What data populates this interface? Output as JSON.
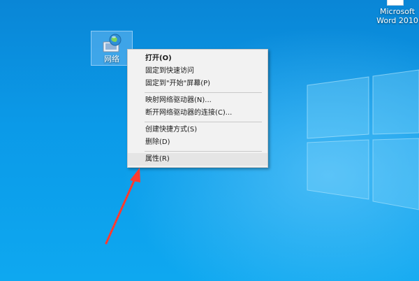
{
  "desktop": {
    "icons": {
      "network": {
        "label": "网络"
      },
      "word": {
        "label_line1": "Microsoft",
        "label_line2": "Word 2010"
      }
    }
  },
  "context_menu": {
    "items": [
      {
        "label": "打开(O)",
        "bold": true
      },
      {
        "label": "固定到快速访问"
      },
      {
        "label": "固定到\"开始\"屏幕(P)"
      },
      {
        "label": "映射网络驱动器(N)..."
      },
      {
        "label": "断开网络驱动器的连接(C)..."
      },
      {
        "label": "创建快捷方式(S)"
      },
      {
        "label": "删除(D)"
      },
      {
        "label": "属性(R)",
        "highlighted": true
      }
    ]
  },
  "colors": {
    "annotation_arrow": "#ff3b30",
    "menu_bg": "#f2f2f2"
  }
}
